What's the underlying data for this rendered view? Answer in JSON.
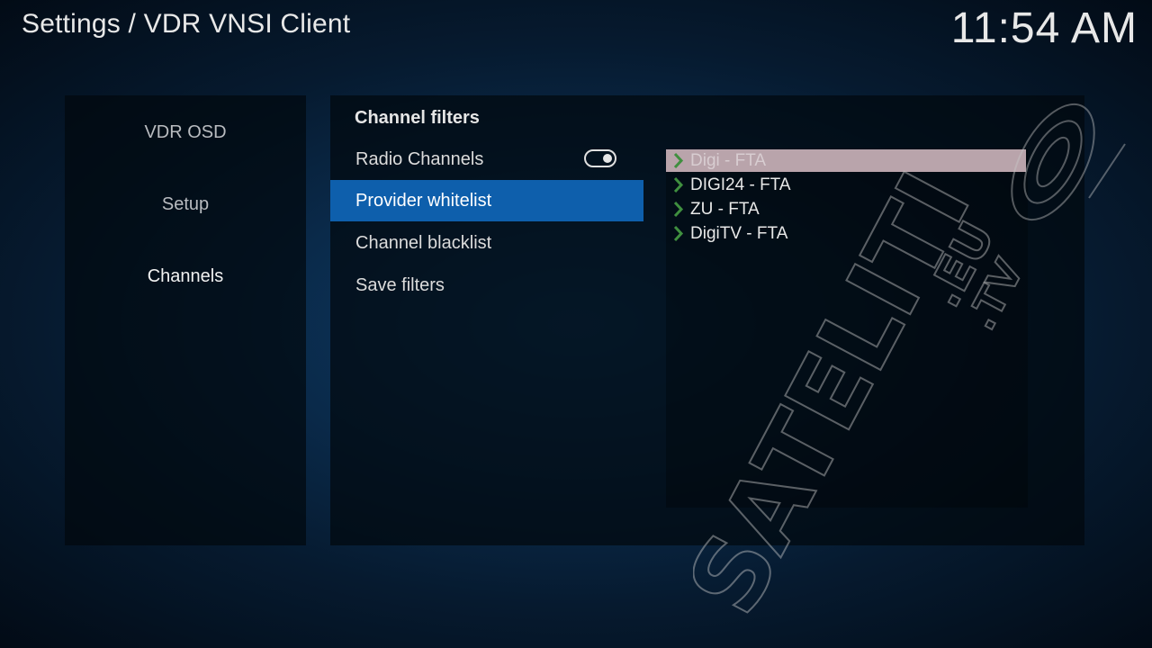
{
  "header": {
    "title": "Settings / VDR VNSI Client",
    "clock": "11:54 AM"
  },
  "sidebar": {
    "items": [
      {
        "label": "VDR OSD"
      },
      {
        "label": "Setup"
      },
      {
        "label": "Channels"
      }
    ],
    "active_index": 2
  },
  "main": {
    "section_title": "Channel filters",
    "menu": [
      {
        "label": "Radio Channels",
        "toggle": true
      },
      {
        "label": "Provider whitelist"
      },
      {
        "label": "Channel blacklist"
      },
      {
        "label": "Save filters"
      }
    ],
    "selected_index": 1
  },
  "providers": {
    "items": [
      {
        "label": "Digi - FTA"
      },
      {
        "label": "DIGI24 - FTA"
      },
      {
        "label": "ZU - FTA"
      },
      {
        "label": "DigiTV - FTA"
      }
    ],
    "focused_index": 0,
    "checked_icon": "chevron-right-icon",
    "check_color": "#3f8f3f"
  },
  "watermark": {
    "text_main": "SATELITI",
    "text_eu": ".EU",
    "text_tv": ".TV"
  },
  "colors": {
    "accent": "#0e5fac",
    "focus_bg": "#b9a4ab"
  }
}
